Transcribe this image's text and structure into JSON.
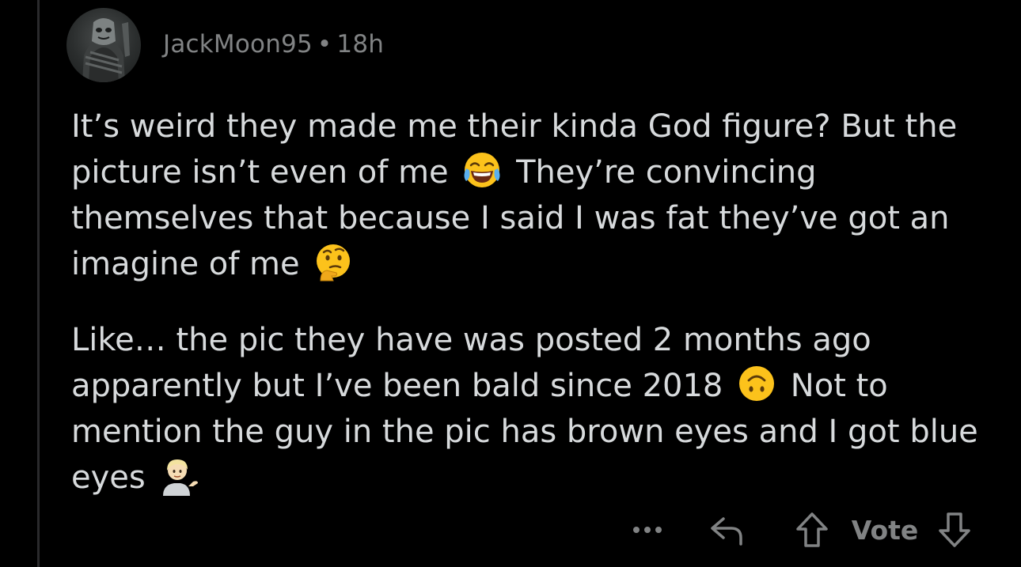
{
  "comment": {
    "username": "JackMoon95",
    "separator": "•",
    "age": "18h",
    "paragraphs": [
      {
        "segments": [
          {
            "text": "It’s weird they made me their kinda God figure? But the picture isn’t even of me "
          },
          {
            "emoji": "face-with-tears-of-joy-icon"
          },
          {
            "text": " They’re convincing themselves that because I said I was fat they’ve got an imagine of me "
          },
          {
            "emoji": "thinking-face-icon"
          }
        ]
      },
      {
        "segments": [
          {
            "text": "Like… the pic they have was posted 2 months ago apparently but I’ve been bald since 2018 "
          },
          {
            "emoji": "upside-down-face-icon"
          },
          {
            "text": " Not to mention the guy in the pic has brown eyes and I got blue eyes "
          },
          {
            "emoji": "person-tipping-hand-icon"
          }
        ]
      }
    ]
  },
  "actions": {
    "more_icon": "more-dots-icon",
    "reply_icon": "reply-arrow-icon",
    "upvote_icon": "upvote-arrow-icon",
    "vote_label": "Vote",
    "downvote_icon": "downvote-arrow-icon"
  },
  "colors": {
    "background": "#000000",
    "text": "#d7dadc",
    "meta": "#818384",
    "thread_line": "#2a2a2c"
  }
}
